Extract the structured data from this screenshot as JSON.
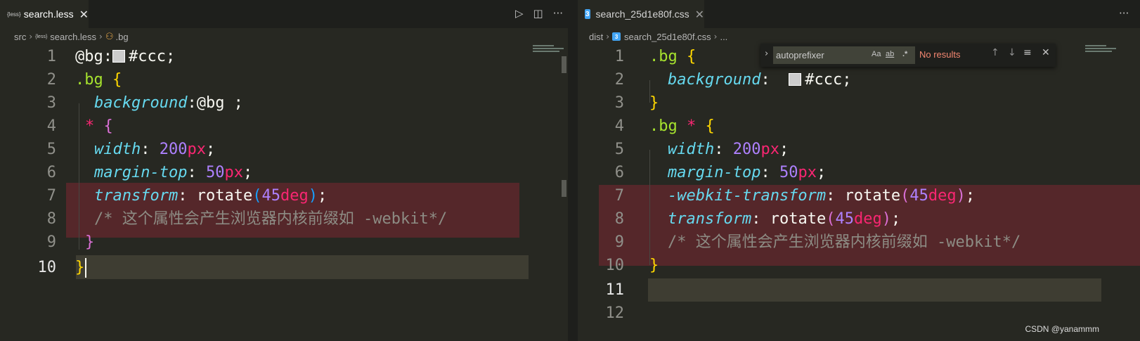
{
  "left_editor": {
    "tab": {
      "icon": "less-file-icon",
      "icon_text": "{less}",
      "filename": "search.less",
      "close": "✕"
    },
    "actions": {
      "run": "▷",
      "split": "◫",
      "more": "···"
    },
    "breadcrumb": [
      "src",
      "search.less",
      ".bg"
    ],
    "line_numbers": [
      "1",
      "2",
      "3",
      "4",
      "5",
      "6",
      "7",
      "8",
      "9",
      "10"
    ],
    "lines": {
      "l1": {
        "var": "@bg",
        "colon": ":",
        "color": "#ccc",
        "semi": ";"
      },
      "l2": {
        "sel": ".bg",
        "brace": "{"
      },
      "l3": {
        "prop": "background",
        "colon": ":",
        "val": "@bg ;"
      },
      "l4": {
        "star": "*",
        "brace": "{"
      },
      "l5": {
        "prop": "width",
        "colon": ": ",
        "num": "200",
        "unit": "px",
        "semi": ";"
      },
      "l6": {
        "prop": "margin-top",
        "colon": ": ",
        "num": "50",
        "unit": "px",
        "semi": ";"
      },
      "l7": {
        "prop": "transform",
        "colon": ": ",
        "fn": "rotate",
        "open": "(",
        "num": "45",
        "unit": "deg",
        "close": ")",
        "semi": ";"
      },
      "l8": {
        "comment": "/* 这个属性会产生浏览器内核前缀如 -webkit*/"
      },
      "l9": {
        "brace": "}"
      },
      "l10": {
        "brace": "}"
      }
    }
  },
  "right_editor": {
    "tab": {
      "icon": "css-file-icon",
      "icon_text": "3",
      "filename": "search_25d1e80f.css",
      "close": "✕"
    },
    "actions": {
      "more": "···"
    },
    "breadcrumb": [
      "dist",
      "search_25d1e80f.css",
      "..."
    ],
    "line_numbers": [
      "1",
      "2",
      "3",
      "4",
      "5",
      "6",
      "7",
      "8",
      "9",
      "10",
      "11",
      "12"
    ],
    "lines": {
      "l1": {
        "sel": ".bg",
        "brace": "{"
      },
      "l2": {
        "prop": "background",
        "colon": ": ",
        "color": "#ccc",
        "semi": ";"
      },
      "l3": {
        "brace": "}"
      },
      "l4": {
        "sel": ".bg",
        "star": "*",
        "brace": "{"
      },
      "l5": {
        "prop": "width",
        "colon": ": ",
        "num": "200",
        "unit": "px",
        "semi": ";"
      },
      "l6": {
        "prop": "margin-top",
        "colon": ": ",
        "num": "50",
        "unit": "px",
        "semi": ";"
      },
      "l7": {
        "prop": "-webkit-transform",
        "colon": ": ",
        "fn": "rotate",
        "open": "(",
        "num": "45",
        "unit": "deg",
        "close": ")",
        "semi": ";"
      },
      "l8": {
        "prop": "transform",
        "colon": ": ",
        "fn": "rotate",
        "open": "(",
        "num": "45",
        "unit": "deg",
        "close": ")",
        "semi": ";"
      },
      "l9": {
        "comment": "/* 这个属性会产生浏览器内核前缀如 -webkit*/"
      },
      "l10": {
        "brace": "}"
      }
    }
  },
  "find_widget": {
    "query": "autoprefixer",
    "match_case": "Aa",
    "whole_word": "ab",
    "regex": ".*",
    "status": "No results",
    "prev": "↑",
    "next": "↓",
    "selection": "≡",
    "close": "✕",
    "expand": "›"
  },
  "watermark": "CSDN @yanammm",
  "colors": {
    "background": "#272822",
    "highlight": "#55272a",
    "current_line": "#3e3d32",
    "swatch": "#cccccc"
  }
}
